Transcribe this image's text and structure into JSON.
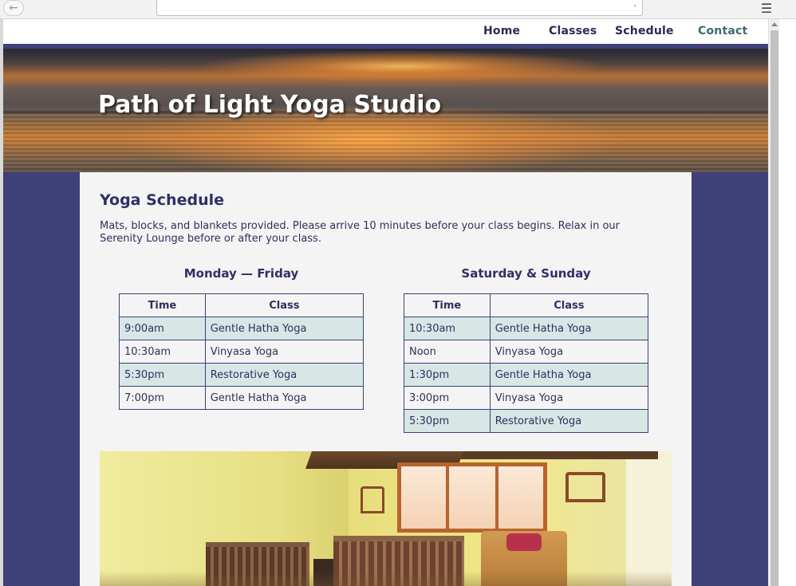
{
  "browser": {
    "back_icon": "arrow-left-icon",
    "menu_icon": "hamburger-icon",
    "url": ""
  },
  "nav": {
    "items": [
      {
        "label": "Home"
      },
      {
        "label": "Classes"
      },
      {
        "label": "Schedule"
      },
      {
        "label": "Contact"
      }
    ],
    "accent": "#3d6b6b"
  },
  "hero": {
    "title": "Path of Light Yoga Studio"
  },
  "main": {
    "heading": "Yoga Schedule",
    "intro": "Mats, blocks, and blankets provided. Please arrive 10 minutes before your class begins. Relax in our Serenity Lounge before or after your class."
  },
  "schedules": [
    {
      "title": "Monday — Friday",
      "headers": [
        "Time",
        "Class"
      ],
      "rows": [
        {
          "time": "9:00am",
          "class": "Gentle Hatha Yoga"
        },
        {
          "time": "10:30am",
          "class": "Vinyasa Yoga"
        },
        {
          "time": "5:30pm",
          "class": "Restorative Yoga"
        },
        {
          "time": "7:00pm",
          "class": "Gentle Hatha Yoga"
        }
      ]
    },
    {
      "title": "Saturday & Sunday",
      "headers": [
        "Time",
        "Class"
      ],
      "rows": [
        {
          "time": "10:30am",
          "class": "Gentle Hatha Yoga"
        },
        {
          "time": "Noon",
          "class": "Vinyasa Yoga"
        },
        {
          "time": "1:30pm",
          "class": "Gentle Hatha Yoga"
        },
        {
          "time": "3:00pm",
          "class": "Vinyasa Yoga"
        },
        {
          "time": "5:30pm",
          "class": "Restorative Yoga"
        }
      ]
    }
  ],
  "colors": {
    "brand": "#3f3f7a",
    "row_alt": "#d7e7e6",
    "content_bg": "#f4f4f4"
  }
}
